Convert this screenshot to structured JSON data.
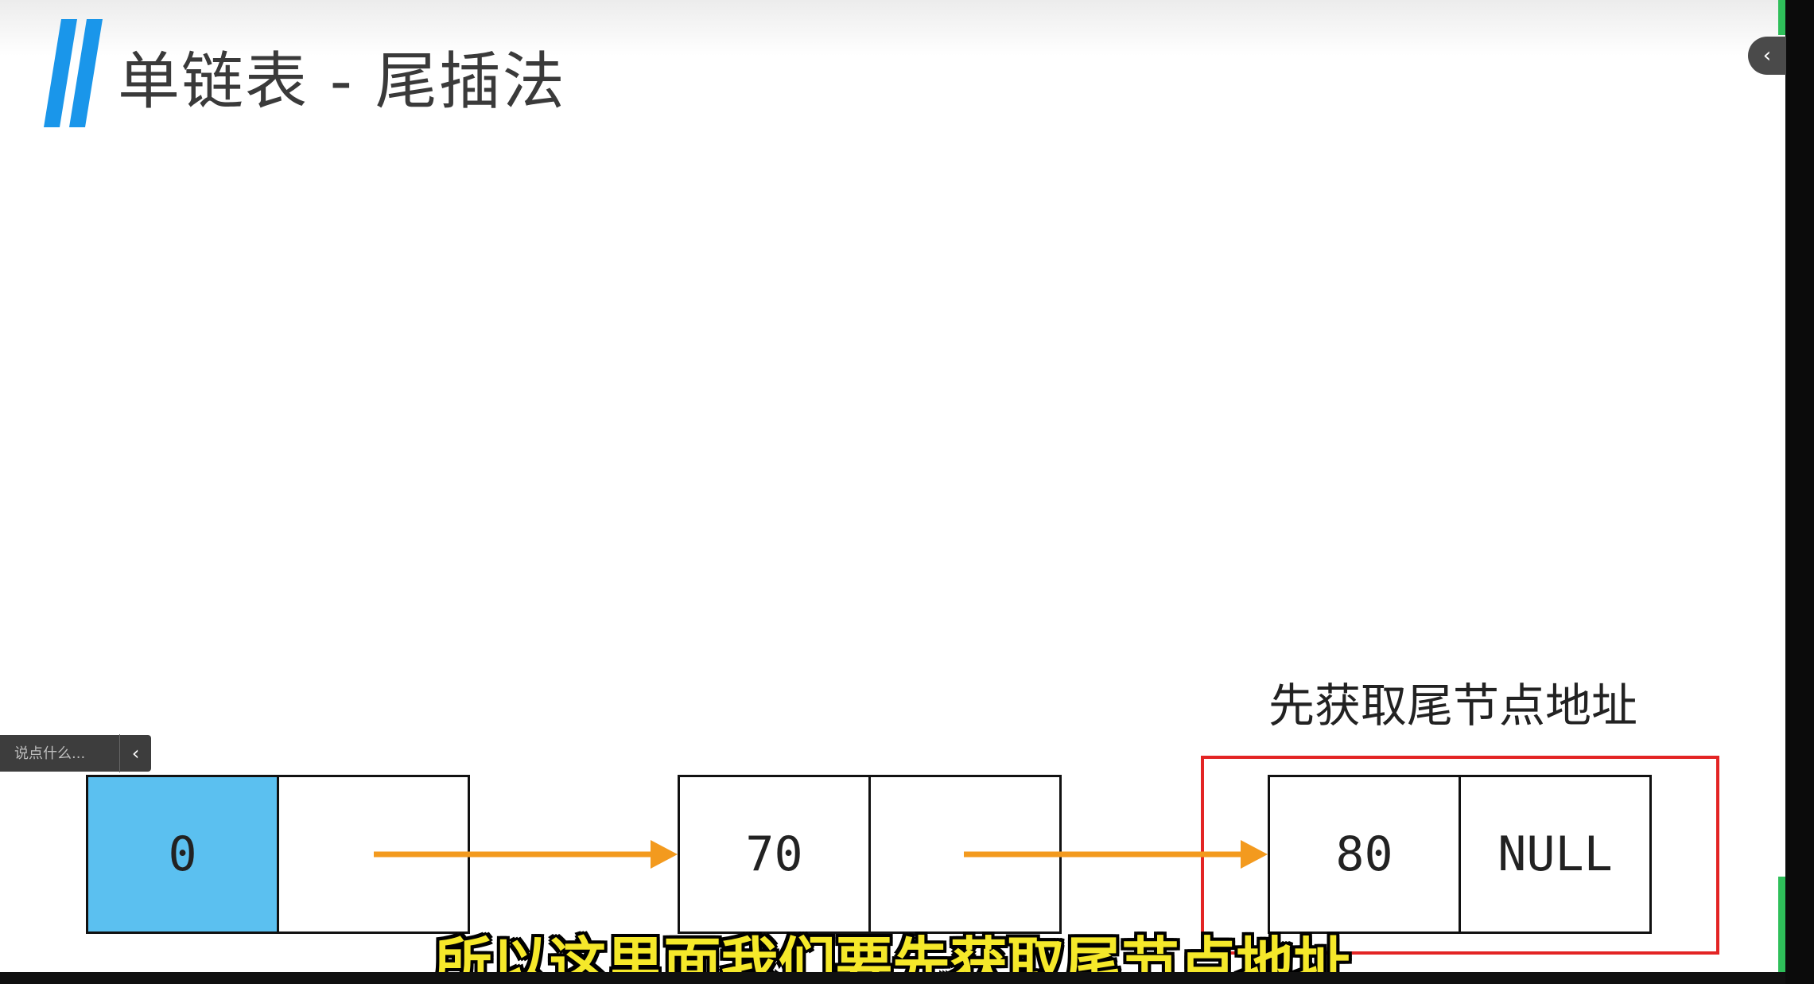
{
  "slide": {
    "title": "单链表 - 尾插法",
    "annotation": "先获取尾节点地址",
    "subtitle": "所以这里面我们要先获取尾节点地址"
  },
  "linked_list": {
    "nodes": [
      {
        "data": "0",
        "next": "",
        "is_head": true
      },
      {
        "data": "70",
        "next": ""
      },
      {
        "data": "80",
        "next": "NULL",
        "highlighted": true
      }
    ]
  },
  "player": {
    "comment_placeholder": "说点什么...",
    "comment_toggle_icon": "‹",
    "collapse_icon": "‹"
  },
  "colors": {
    "head_fill": "#5bc0f0",
    "arrow": "#f39a1e",
    "highlight_border": "#e32424",
    "title_bar": "#1a96ea",
    "subtitle_text": "#f5e82a",
    "side_accent": "#2fbf5a"
  }
}
